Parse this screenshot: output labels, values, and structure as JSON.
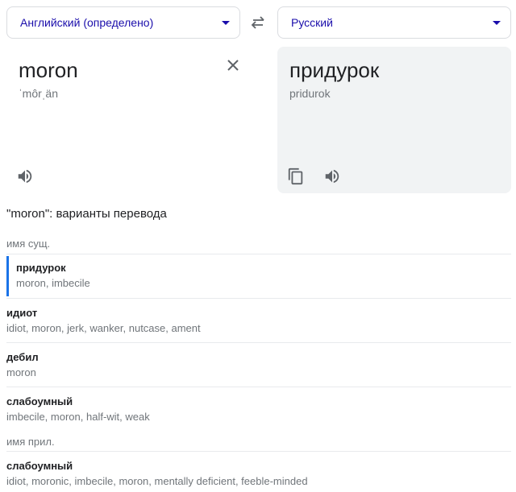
{
  "languages": {
    "source": "Английский (определено)",
    "target": "Русский"
  },
  "source": {
    "word": "moron",
    "phonetic": "ˈmôrˌän"
  },
  "target": {
    "word": "придурок",
    "transliteration": "pridurok"
  },
  "variants": {
    "title": "\"moron\": варианты перевода",
    "noun_label": "имя сущ.",
    "adj_label": "имя прил.",
    "noun_entries": [
      {
        "word": "придурок",
        "synonyms": "moron, imbecile"
      },
      {
        "word": "идиот",
        "synonyms": "idiot, moron, jerk, wanker, nutcase, ament"
      },
      {
        "word": "дебил",
        "synonyms": "moron"
      },
      {
        "word": "слабоумный",
        "synonyms": "imbecile, moron, half-wit, weak"
      }
    ],
    "adj_entries": [
      {
        "word": "слабоумный",
        "synonyms": "idiot, moronic, imbecile, moron, mentally deficient, feeble-minded"
      }
    ]
  },
  "icons": {
    "swap": "swap-arrows-icon",
    "clear": "close-icon",
    "speak": "speaker-icon",
    "copy": "copy-icon",
    "dropdown": "caret-down-icon"
  },
  "colors": {
    "accent": "#1a73e8",
    "link": "#1a0dab",
    "panel": "#f1f3f4",
    "muted": "#70757a"
  }
}
